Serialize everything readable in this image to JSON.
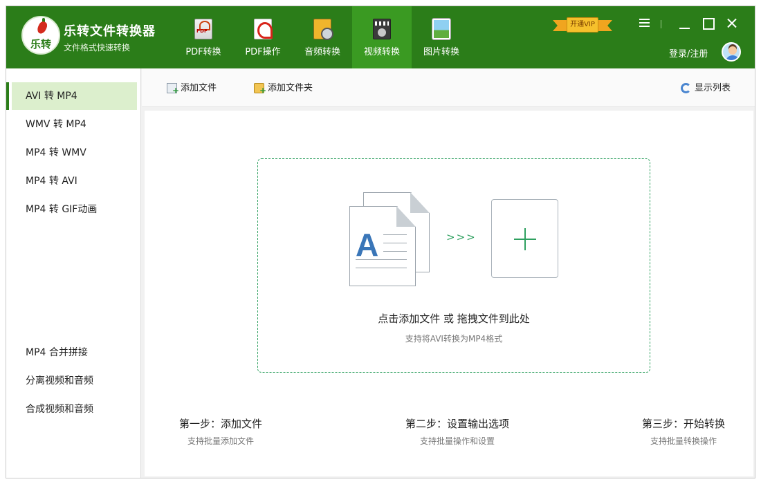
{
  "app": {
    "logo_text": "乐转",
    "name": "乐转文件转换器",
    "subtitle": "文件格式快速转换"
  },
  "topnav": [
    {
      "label": "PDF转换",
      "icon": "pdf-file-icon"
    },
    {
      "label": "PDF操作",
      "icon": "acrobat-icon"
    },
    {
      "label": "音频转换",
      "icon": "audio-wav-icon"
    },
    {
      "label": "视频转换",
      "icon": "video-avi-icon",
      "active": true
    },
    {
      "label": "图片转换",
      "icon": "image-icon"
    }
  ],
  "vip": {
    "label": "开通VIP"
  },
  "user": {
    "login_label": "登录/注册"
  },
  "sidebar": {
    "items": [
      {
        "label": "AVI 转 MP4",
        "active": true
      },
      {
        "label": "WMV 转 MP4"
      },
      {
        "label": "MP4 转 WMV"
      },
      {
        "label": "MP4 转 AVI"
      },
      {
        "label": "MP4 转 GIF动画"
      },
      {
        "label": "MP4 合并拼接"
      },
      {
        "label": "分离视频和音频"
      },
      {
        "label": "合成视频和音频"
      }
    ]
  },
  "toolbar": {
    "add_file": "添加文件",
    "add_folder": "添加文件夹",
    "show_list": "显示列表"
  },
  "dropzone": {
    "doc_letter": "A",
    "arrows": ">>>",
    "main_text": "点击添加文件 或 拖拽文件到此处",
    "sub_text": "支持将AVI转换为MP4格式"
  },
  "steps": [
    {
      "title": "第一步：添加文件",
      "desc": "支持批量添加文件"
    },
    {
      "title": "第二步：设置输出选项",
      "desc": "支持批量操作和设置"
    },
    {
      "title": "第三步：开始转换",
      "desc": "支持批量转换操作"
    }
  ],
  "colors": {
    "brand_green": "#2b7d19",
    "active_tab_green": "#3a9a22",
    "active_side_bg": "#dcefcd",
    "dropzone_green": "#2fa060"
  }
}
